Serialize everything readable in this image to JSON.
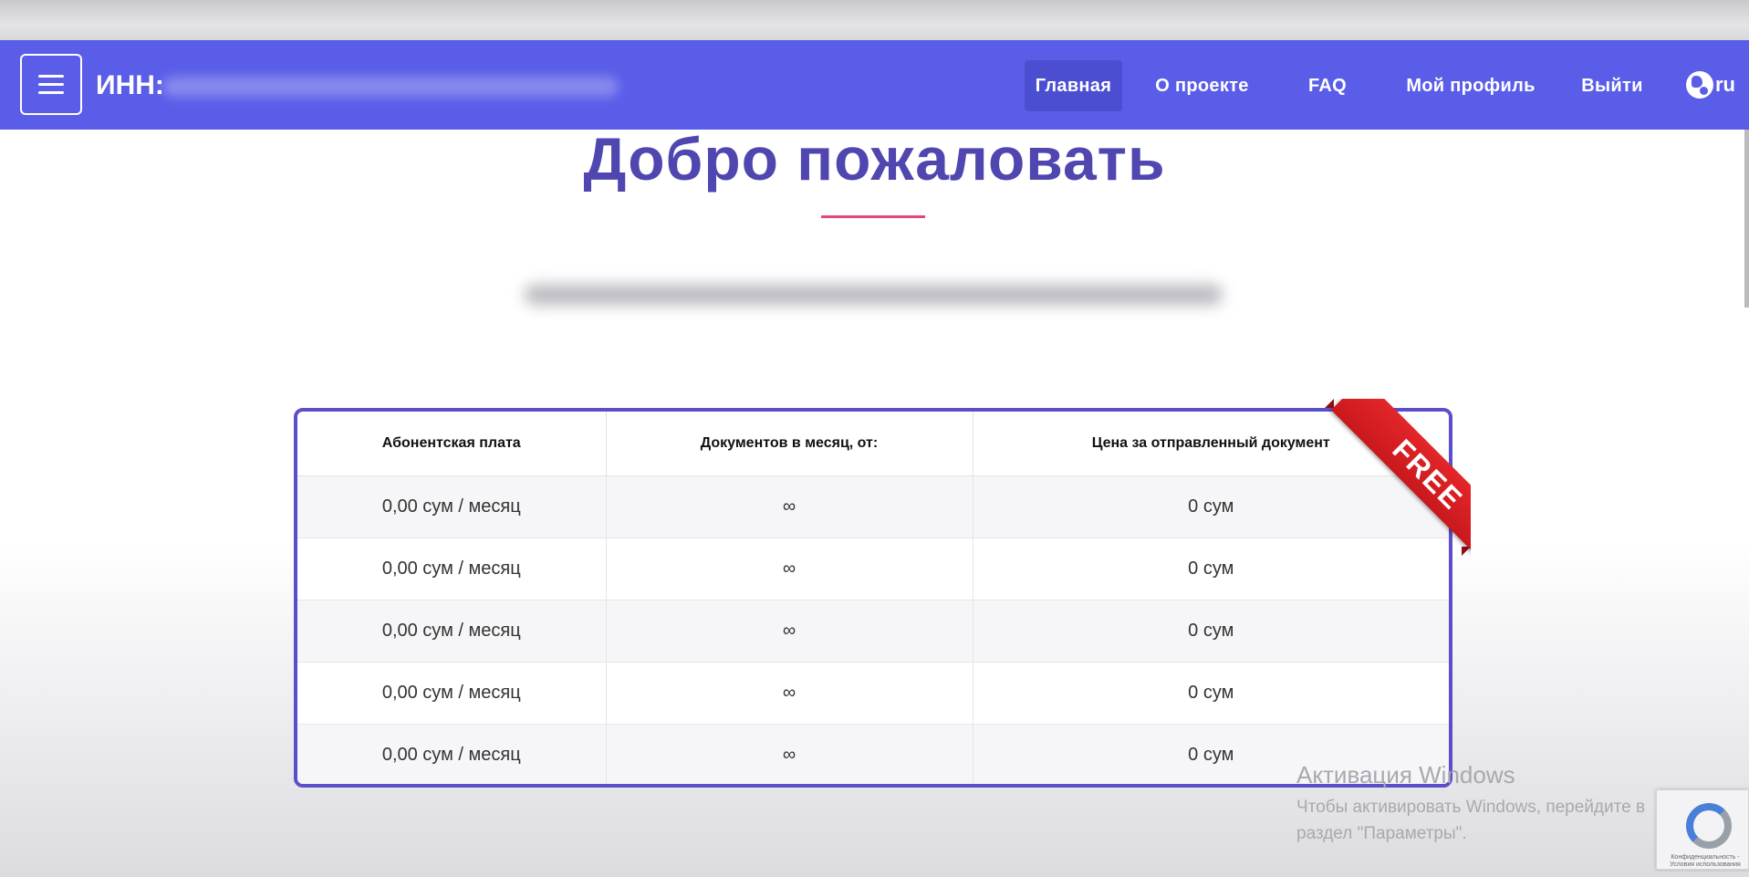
{
  "navbar": {
    "inn_label": "ИНН:",
    "items": [
      {
        "label": "Главная",
        "active": true
      },
      {
        "label": "О проекте"
      },
      {
        "label": "FAQ"
      },
      {
        "label": "Мой профиль"
      },
      {
        "label": "Выйти"
      }
    ],
    "lang": "ru"
  },
  "hero": {
    "title": "Добро пожаловать"
  },
  "pricing": {
    "badge": "FREE",
    "headers": [
      "Абонентская плата",
      "Документов в месяц, от:",
      "Цена за отправленный документ"
    ],
    "rows": [
      [
        "0,00 сум / месяц",
        "∞",
        "0 сум"
      ],
      [
        "0,00 сум / месяц",
        "∞",
        "0 сум"
      ],
      [
        "0,00 сум / месяц",
        "∞",
        "0 сум"
      ],
      [
        "0,00 сум / месяц",
        "∞",
        "0 сум"
      ],
      [
        "0,00 сум / месяц",
        "∞",
        "0 сум"
      ]
    ]
  },
  "windows_activation": {
    "title": "Активация Windows",
    "line1": "Чтобы активировать Windows, перейдите в",
    "line2": "раздел \"Параметры\"."
  },
  "recaptcha": {
    "text": "Конфиденциальность - Условия использования"
  },
  "colors": {
    "navbar": "#5a5de8",
    "title": "#5046b0",
    "accent_line": "#e0457b",
    "table_border": "#5a4fc8",
    "ribbon": "#d81f23"
  },
  "icons": {
    "menu": "hamburger-icon",
    "language": "globe-icon",
    "captcha": "recaptcha-icon"
  }
}
